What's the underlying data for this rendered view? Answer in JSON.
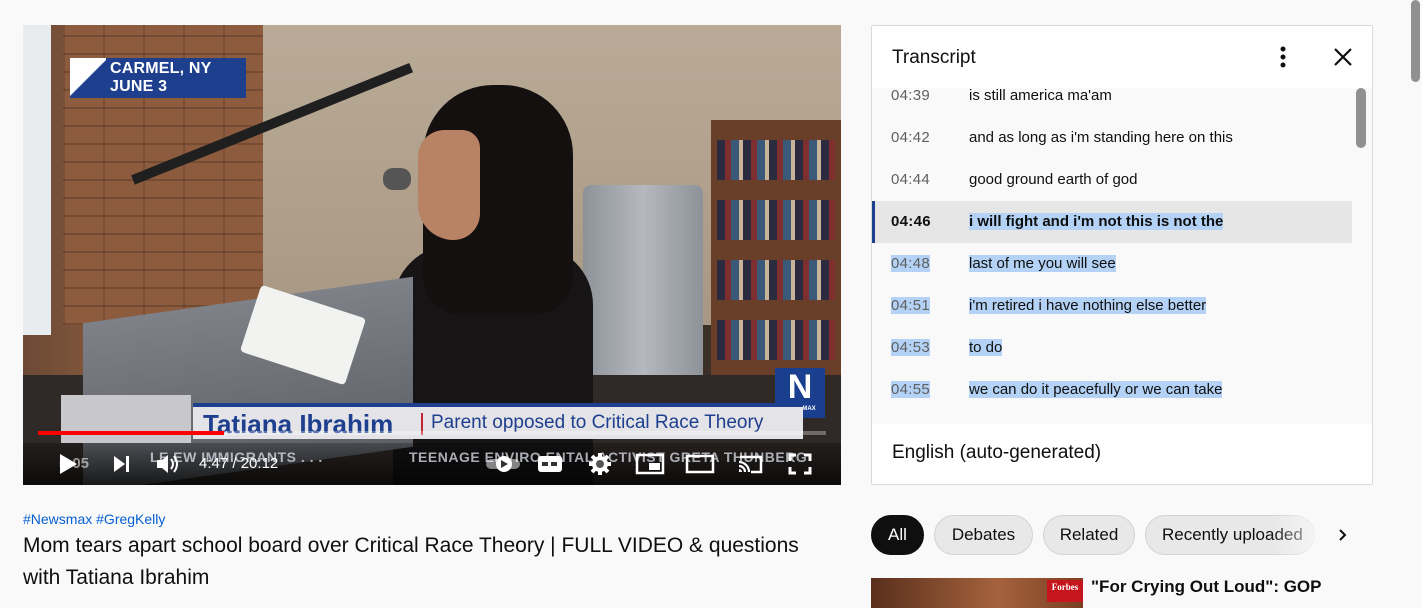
{
  "player": {
    "dateline": {
      "city": "CARMEL, NY",
      "date": "JUNE 3"
    },
    "network_logo": {
      "letter": "N",
      "word": "NEWSMAX"
    },
    "lower_third": {
      "name": "Tatiana Ibrahim",
      "role": "Parent opposed to Critical Race Theory"
    },
    "ticker": {
      "left": "LE   EW IMMIGRANTS . . .",
      "right": "TEENAGE ENVIRO   ENTAL ACTIVIST GRETA THUNBERG"
    },
    "progress_fraction": 0.236,
    "ghost_time": "5:05",
    "time": {
      "current": "4:47",
      "separator": " / ",
      "duration": "20:12"
    },
    "controls": {
      "play": "play-icon",
      "next": "next-icon",
      "volume": "volume-icon",
      "autoplay": "autoplay-toggle-icon",
      "captions": "captions-icon",
      "settings": "settings-icon",
      "miniplayer": "miniplayer-icon",
      "theater": "theater-icon",
      "cast": "cast-icon",
      "fullscreen": "fullscreen-icon"
    }
  },
  "video": {
    "hashtags": [
      "#Newsmax",
      "#GregKelly"
    ],
    "title_line1": "Mom tears apart school board over Critical Race Theory | FULL VIDEO & questions",
    "title_line2": "with Tatiana Ibrahim"
  },
  "transcript": {
    "title": "Transcript",
    "language": "English (auto-generated)",
    "segments": [
      {
        "time": "04:39",
        "text": "is still america ma'am",
        "active": false,
        "selected": false
      },
      {
        "time": "04:42",
        "text": "and as long as i'm standing here on this",
        "active": false,
        "selected": false
      },
      {
        "time": "04:44",
        "text": "good ground earth of god",
        "active": false,
        "selected": false
      },
      {
        "time": "04:46",
        "text": "i will fight and i'm not this is not the",
        "active": true,
        "selected": true
      },
      {
        "time": "04:48",
        "text": "last of me you will see",
        "active": false,
        "selected": true
      },
      {
        "time": "04:51",
        "text": "i'm retired i have nothing else better",
        "active": false,
        "selected": true
      },
      {
        "time": "04:53",
        "text": "to do",
        "active": false,
        "selected": true
      },
      {
        "time": "04:55",
        "text": "we can do it peacefully or we can take",
        "active": false,
        "selected": true
      }
    ]
  },
  "chips": [
    {
      "label": "All",
      "selected": true
    },
    {
      "label": "Debates",
      "selected": false
    },
    {
      "label": "Related",
      "selected": false
    },
    {
      "label": "Recently uploaded",
      "selected": false
    }
  ],
  "recommendation": {
    "badge": "Forbes",
    "title": "\"For Crying Out Loud\": GOP"
  },
  "colors": {
    "accent_red": "#ff0000",
    "link_blue": "#065fd4",
    "newsmax_blue": "#1d3f8e",
    "selection": "#b3d2f5"
  }
}
